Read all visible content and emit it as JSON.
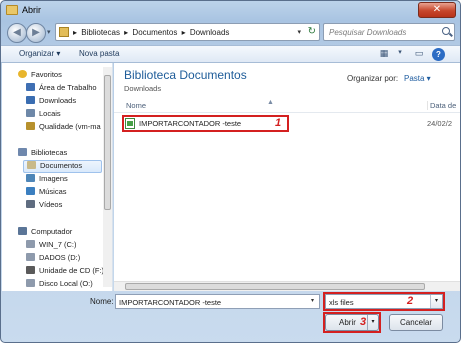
{
  "window": {
    "title": "Abrir",
    "close_label": "✕"
  },
  "navbar": {
    "back_label": "◀",
    "forward_label": "▶",
    "history_label": "▾",
    "breadcrumbs": [
      "Bibliotecas",
      "Documentos",
      "Downloads"
    ],
    "separator": "▸",
    "refresh_label": "↻",
    "search_placeholder": "Pesquisar Downloads"
  },
  "toolbar": {
    "organize_label": "Organizar ▾",
    "new_folder_label": "Nova pasta",
    "views_label": "▦",
    "views_drop_label": "▾",
    "pane_label": "▭",
    "help_label": "?"
  },
  "sidebar": {
    "favorites": {
      "label": "Favoritos",
      "color": "#e8b52c"
    },
    "favorites_items": [
      {
        "label": "Área de Trabalho",
        "color": "#3f6fb3"
      },
      {
        "label": "Downloads",
        "color": "#3a6db1"
      },
      {
        "label": "Locais",
        "color": "#6e88a8"
      },
      {
        "label": "Qualidade (vm-ma",
        "color": "#b7912d"
      }
    ],
    "libraries": {
      "label": "Bibliotecas",
      "color": "#6f88ad"
    },
    "libraries_items": [
      {
        "label": "Documentos",
        "color": "#c8b989",
        "selected": true
      },
      {
        "label": "Imagens",
        "color": "#4e86b8"
      },
      {
        "label": "Músicas",
        "color": "#3b7fc0"
      },
      {
        "label": "Vídeos",
        "color": "#5f6c80"
      }
    ],
    "computer": {
      "label": "Computador",
      "color": "#5b7597"
    },
    "computer_items": [
      {
        "label": "WIN_7 (C:)",
        "color": "#8e9aac"
      },
      {
        "label": "DADOS (D:)",
        "color": "#8e9aac"
      },
      {
        "label": "Unidade de CD (F:)",
        "color": "#5a5a5a"
      },
      {
        "label": "Disco Local (O:)",
        "color": "#8e9aac"
      }
    ]
  },
  "main": {
    "library_title": "Biblioteca Documentos",
    "library_subtitle": "Downloads",
    "arrange_label": "Organizar por:",
    "arrange_value": "Pasta ▾",
    "column_name": "Nome",
    "column_date": "Data de",
    "sort_indicator": "▲",
    "files": [
      {
        "name": "IMPORTARCONTADOR -teste",
        "date": "24/02/2"
      }
    ]
  },
  "footer": {
    "name_label": "Nome:",
    "name_value": "IMPORTARCONTADOR -teste",
    "name_drop": "▾",
    "type_value": "xls files",
    "type_drop": "▾",
    "open_label": "Abrir",
    "open_split": "▾",
    "cancel_label": "Cancelar"
  },
  "annotations": {
    "one": "1",
    "two": "2",
    "three": "3",
    "color": "#d42020"
  }
}
